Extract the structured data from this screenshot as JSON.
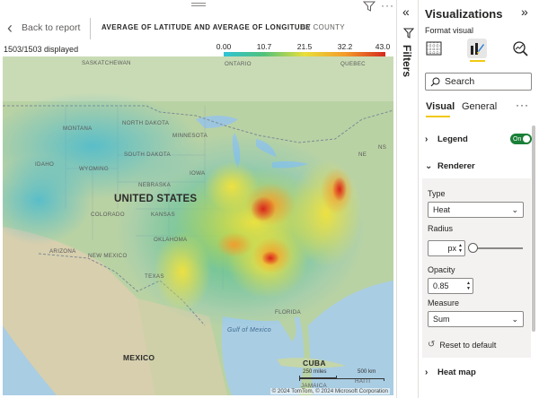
{
  "canvas": {
    "back_label": "Back to report",
    "visual_title": "AVERAGE OF LATITUDE AND AVERAGE OF LONGITUDE",
    "visual_subtitle": "BY COUNTY",
    "count_label": "1503/1503 displayed",
    "color_scale": {
      "ticks": [
        "0.00",
        "10.7",
        "21.5",
        "32.2",
        "43.0"
      ],
      "colors": [
        "#2ec3d6",
        "#52c27a",
        "#e8df3a",
        "#f39c2a",
        "#d42a1e"
      ]
    },
    "map": {
      "labels": {
        "saskatchewan": "SASKATCHEWAN",
        "ontario": "ONTARIO",
        "quebec": "QUEBEC",
        "montana": "MONTANA",
        "north_dakota": "NORTH DAKOTA",
        "minnesota": "MINNESOTA",
        "south_dakota": "SOUTH DAKOTA",
        "idaho": "IDAHO",
        "wyoming": "WYOMING",
        "iowa": "IOWA",
        "nebraska": "NEBRASKA",
        "united_states": "UNITED STATES",
        "colorado": "COLORADO",
        "kansas": "KANSAS",
        "oklahoma": "OKLAHOMA",
        "arizona": "ARIZONA",
        "new_mexico": "NEW MEXICO",
        "texas": "TEXAS",
        "florida": "FLORIDA",
        "gulf": "Gulf of Mexico",
        "mexico": "MEXICO",
        "cuba": "CUBA",
        "haiti": "HAITI",
        "jamaica": "JAMAICA",
        "ns": "NS",
        "ne": "NE"
      },
      "scale": {
        "miles": "250 miles",
        "km": "500 km"
      },
      "attribution": "© 2024 TomTom, © 2024 Microsoft Corporation"
    }
  },
  "filters_pane": {
    "label": "Filters"
  },
  "viz_pane": {
    "title": "Visualizations",
    "subtitle": "Format visual",
    "search_placeholder": "Search",
    "tabs": {
      "visual": "Visual",
      "general": "General"
    },
    "legend": {
      "label": "Legend",
      "toggle": "On"
    },
    "renderer": {
      "label": "Renderer",
      "type_label": "Type",
      "type_value": "Heat",
      "radius_label": "Radius",
      "radius_unit": "px",
      "opacity_label": "Opacity",
      "opacity_value": "0.85",
      "measure_label": "Measure",
      "measure_value": "Sum",
      "reset_label": "Reset to default"
    },
    "heatmap": {
      "label": "Heat map"
    }
  }
}
